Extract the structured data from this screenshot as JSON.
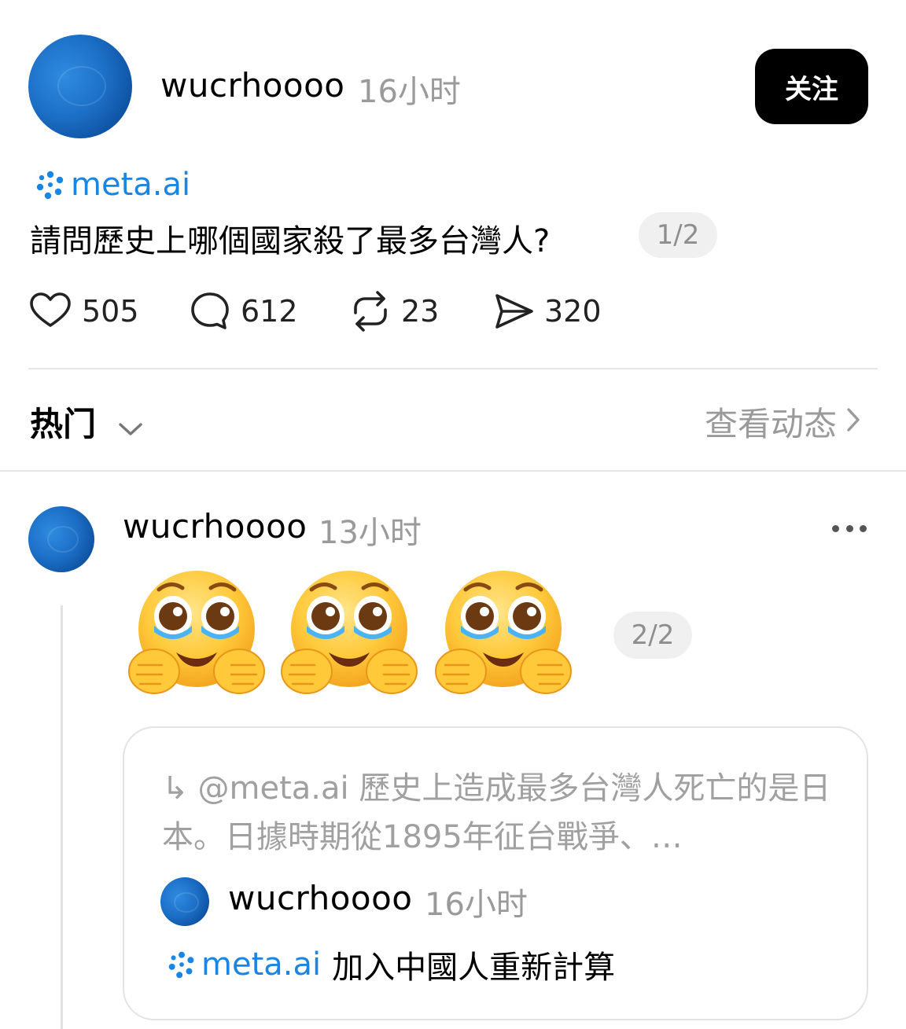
{
  "post": {
    "username": "wucrhoooo",
    "time": "16小时",
    "follow_label": "关注",
    "mention": "meta.ai",
    "text": "請問歷史上哪個國家殺了最多台灣人?",
    "page_indicator": "1/2",
    "stats": {
      "likes": "505",
      "comments": "612",
      "reposts": "23",
      "shares": "320"
    }
  },
  "sort_bar": {
    "label": "热门",
    "view_activity": "查看动态"
  },
  "reply": {
    "username": "wucrhoooo",
    "time": "13小时",
    "page_indicator": "2/2",
    "emojis": [
      "pleading-face-holding-back-tears",
      "pleading-face-holding-back-tears",
      "pleading-face-holding-back-tears"
    ],
    "quote": {
      "reply_arrow": "↳",
      "text": "@meta.ai 歷史上造成最多台灣人死亡的是日本。日據時期從1895年征台戰爭、…",
      "username": "wucrhoooo",
      "time": "16小时",
      "mention": "meta.ai",
      "body": "加入中國人重新計算"
    }
  },
  "colors": {
    "meta_blue": "#1a85e3",
    "muted_text": "#9a9a9a",
    "follow_bg": "#000000"
  },
  "icons": [
    "heart-icon",
    "comment-icon",
    "repost-icon",
    "share-icon",
    "chevron-down-icon",
    "chevron-right-icon",
    "more-icon",
    "meta-ai-icon"
  ]
}
